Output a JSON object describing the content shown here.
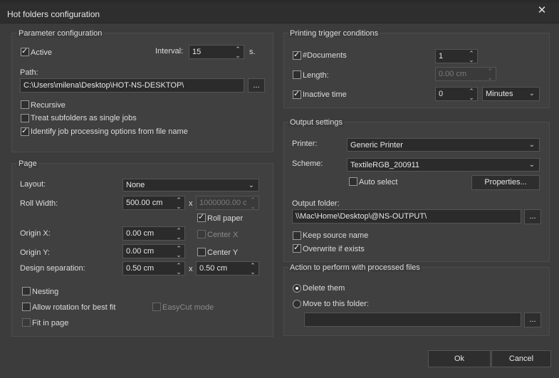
{
  "window": {
    "title": "Hot folders configuration",
    "close_glyph": "✕"
  },
  "param": {
    "title": "Parameter configuration",
    "active_label": "Active",
    "active_checked": true,
    "interval_label": "Interval:",
    "interval_value": "15",
    "interval_unit": "s.",
    "path_label": "Path:",
    "path_value": "C:\\Users\\milena\\Desktop\\HOT-NS-DESKTOP\\",
    "browse_label": "...",
    "recursive_label": "Recursive",
    "recursive_checked": false,
    "treat_label": "Treat subfolders as single jobs",
    "treat_checked": false,
    "identify_label": "Identify job processing options from file name",
    "identify_checked": true
  },
  "page": {
    "title": "Page",
    "layout_label": "Layout:",
    "layout_value": "None",
    "roll_width_label": "Roll Width:",
    "roll_width_value": "500.00 cm",
    "x_glyph": "x",
    "roll_height_value": "1000000.00 cm",
    "roll_paper_label": "Roll paper",
    "roll_paper_checked": true,
    "origin_x_label": "Origin X:",
    "origin_x_value": "0.00 cm",
    "center_x_label": "Center X",
    "origin_y_label": "Origin Y:",
    "origin_y_value": "0.00 cm",
    "center_y_label": "Center Y",
    "design_sep_label": "Design separation:",
    "design_sep_x_value": "0.50 cm",
    "design_sep_y_value": "0.50 cm",
    "nesting_label": "Nesting",
    "allow_rotation_label": "Allow rotation for best fit",
    "easycut_label": "EasyCut mode",
    "fit_label": "Fit in page"
  },
  "trigger": {
    "title": "Printing trigger conditions",
    "documents_label": "#Documents",
    "documents_checked": true,
    "documents_value": "1",
    "length_label": "Length:",
    "length_checked": false,
    "length_value": "0.00 cm",
    "inactive_label": "Inactive time",
    "inactive_checked": true,
    "inactive_value": "0",
    "inactive_unit": "Minutes"
  },
  "output": {
    "title": "Output settings",
    "printer_label": "Printer:",
    "printer_value": "Generic Printer",
    "scheme_label": "Scheme:",
    "scheme_value": "TextileRGB_200911",
    "auto_select_label": "Auto select",
    "properties_label": "Properties...",
    "folder_label": "Output folder:",
    "folder_value": "\\\\Mac\\Home\\Desktop\\@NS-OUTPUT\\",
    "browse_label": "...",
    "keep_source_label": "Keep source name",
    "keep_source_checked": false,
    "overwrite_label": "Overwrite if exists",
    "overwrite_checked": true
  },
  "action": {
    "title": "Action to perform with processed files",
    "delete_label": "Delete them",
    "move_label": "Move to this folder:",
    "move_value": "",
    "browse_label": "..."
  },
  "buttons": {
    "ok": "Ok",
    "cancel": "Cancel"
  }
}
